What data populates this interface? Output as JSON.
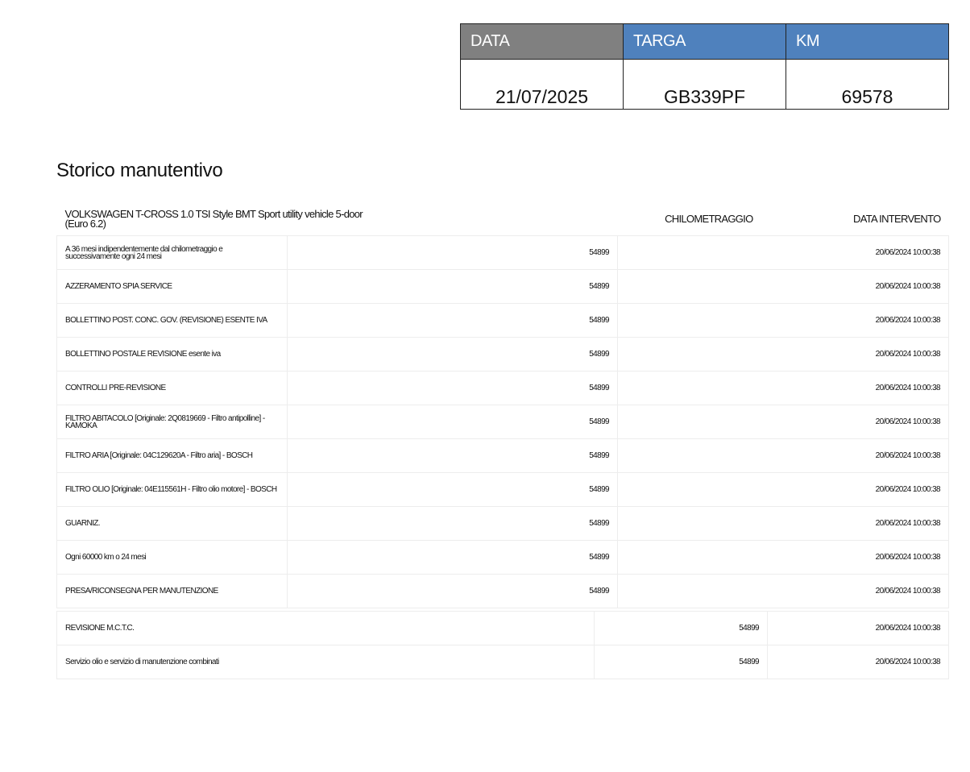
{
  "header": {
    "columns": [
      {
        "label": "DATA",
        "color": "#808080"
      },
      {
        "label": "TARGA",
        "color": "#4f81bd"
      },
      {
        "label": "KM",
        "color": "#4f81bd"
      }
    ],
    "values": {
      "data": "21/07/2025",
      "targa": "GB339PF",
      "km": "69578"
    }
  },
  "section_title": "Storico manutentivo",
  "table": {
    "vehicle": "VOLKSWAGEN T-CROSS 1.0 TSI Style BMT Sport utility vehicle 5-door (Euro 6.2)",
    "col_km": "CHILOMETRAGGIO",
    "col_date": "DATA INTERVENTO",
    "rows": [
      {
        "desc": "A 36 mesi indipendentemente dal chilometraggio e successivamente ogni 24 mesi",
        "km": "54899",
        "date": "20/06/2024 10:00:38"
      },
      {
        "desc": "AZZERAMENTO SPIA SERVICE",
        "km": "54899",
        "date": "20/06/2024 10:00:38"
      },
      {
        "desc": "BOLLETTINO POST. CONC. GOV. (REVISIONE) ESENTE IVA",
        "km": "54899",
        "date": "20/06/2024 10:00:38"
      },
      {
        "desc": "BOLLETTINO POSTALE REVISIONE esente iva",
        "km": "54899",
        "date": "20/06/2024 10:00:38"
      },
      {
        "desc": "CONTROLLI PRE-REVISIONE",
        "km": "54899",
        "date": "20/06/2024 10:00:38"
      },
      {
        "desc": "FILTRO ABITACOLO [Originale: 2Q0819669 - Filtro antipolline] - KAMOKA",
        "km": "54899",
        "date": "20/06/2024 10:00:38"
      },
      {
        "desc": "FILTRO ARIA [Originale: 04C129620A - Filtro aria] - BOSCH",
        "km": "54899",
        "date": "20/06/2024 10:00:38"
      },
      {
        "desc": "FILTRO OLIO [Originale: 04E115561H - Filtro olio motore] - BOSCH",
        "km": "54899",
        "date": "20/06/2024 10:00:38"
      },
      {
        "desc": "GUARNIZ.",
        "km": "54899",
        "date": "20/06/2024 10:00:38"
      },
      {
        "desc": "Ogni 60000 km o 24 mesi",
        "km": "54899",
        "date": "20/06/2024 10:00:38"
      },
      {
        "desc": "PRESA/RICONSEGNA PER MANUTENZIONE",
        "km": "54899",
        "date": "20/06/2024 10:00:38"
      }
    ],
    "rows2": [
      {
        "desc": "REVISIONE M.C.T.C.",
        "km": "54899",
        "date": "20/06/2024 10:00:38"
      },
      {
        "desc": "Servizio olio e servizio di manutenzione combinati",
        "km": "54899",
        "date": "20/06/2024 10:00:38"
      }
    ]
  }
}
